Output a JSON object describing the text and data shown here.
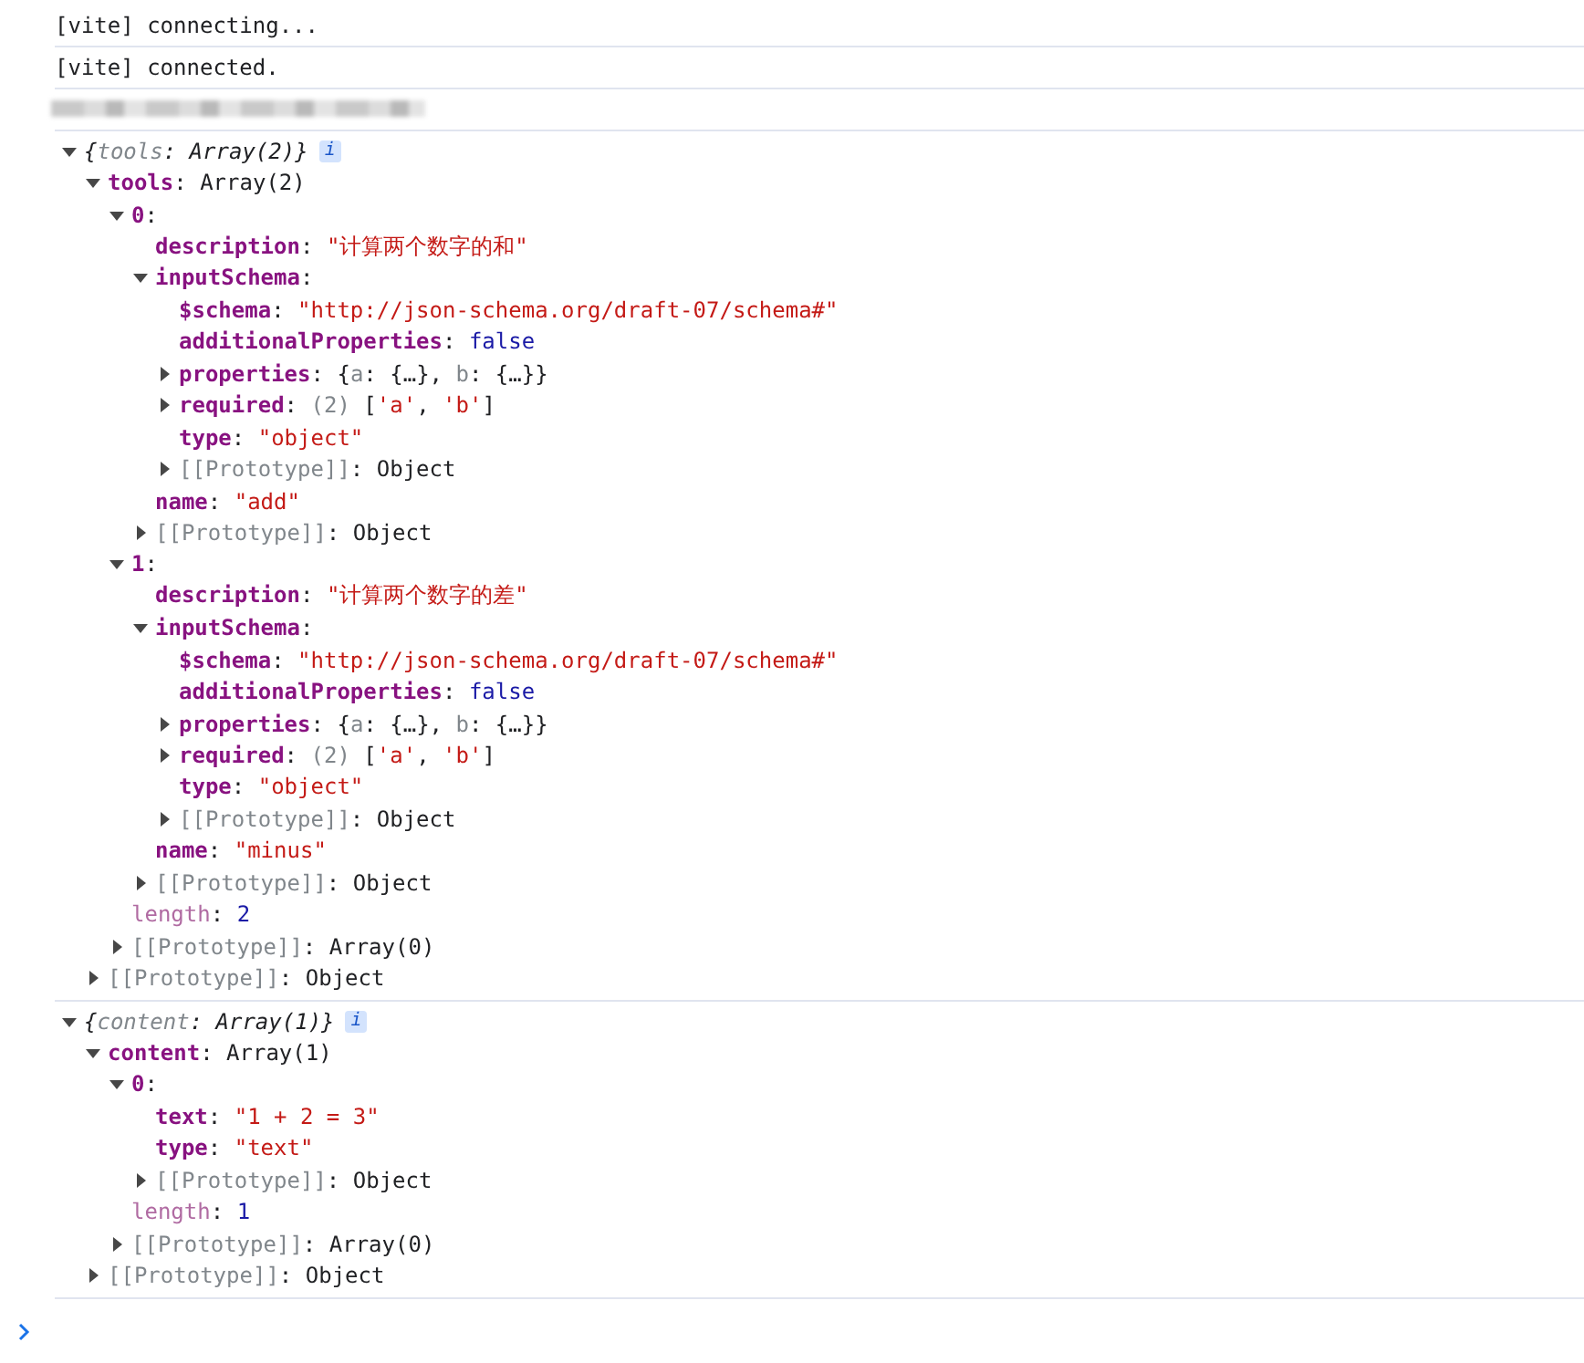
{
  "messages": [
    {
      "kind": "text",
      "text": "[vite] connecting..."
    },
    {
      "kind": "text",
      "text": "[vite] connected."
    },
    {
      "kind": "redacted"
    },
    {
      "kind": "object",
      "expanded": true,
      "summary": [
        {
          "text": "{",
          "kind": "plain"
        },
        {
          "text": "tools",
          "kind": "dim"
        },
        {
          "text": ": Array(2)}",
          "kind": "plain"
        }
      ],
      "badge": "i",
      "children": [
        {
          "expanded": true,
          "line": [
            {
              "text": "tools",
              "kind": "key"
            },
            {
              "text": ": Array(2)",
              "kind": "plain"
            }
          ],
          "children": [
            {
              "expanded": true,
              "line": [
                {
                  "text": "0",
                  "kind": "key"
                },
                {
                  "text": ":",
                  "kind": "plain"
                }
              ],
              "children": [
                {
                  "line": [
                    {
                      "text": "description",
                      "kind": "key"
                    },
                    {
                      "text": ": ",
                      "kind": "plain"
                    },
                    {
                      "text": "\"计算两个数字的和\"",
                      "kind": "string"
                    }
                  ]
                },
                {
                  "expanded": true,
                  "line": [
                    {
                      "text": "inputSchema",
                      "kind": "key"
                    },
                    {
                      "text": ":",
                      "kind": "plain"
                    }
                  ],
                  "children": [
                    {
                      "line": [
                        {
                          "text": "$schema",
                          "kind": "key"
                        },
                        {
                          "text": ": ",
                          "kind": "plain"
                        },
                        {
                          "text": "\"http://json-schema.org/draft-07/schema#\"",
                          "kind": "string"
                        }
                      ]
                    },
                    {
                      "line": [
                        {
                          "text": "additionalProperties",
                          "kind": "key"
                        },
                        {
                          "text": ": ",
                          "kind": "plain"
                        },
                        {
                          "text": "false",
                          "kind": "keyword"
                        }
                      ]
                    },
                    {
                      "expanded": false,
                      "line": [
                        {
                          "text": "properties",
                          "kind": "key"
                        },
                        {
                          "text": ": {",
                          "kind": "plain"
                        },
                        {
                          "text": "a",
                          "kind": "dim"
                        },
                        {
                          "text": ": {…}, ",
                          "kind": "plain"
                        },
                        {
                          "text": "b",
                          "kind": "dim"
                        },
                        {
                          "text": ": {…}}",
                          "kind": "plain"
                        }
                      ]
                    },
                    {
                      "expanded": false,
                      "line": [
                        {
                          "text": "required",
                          "kind": "key"
                        },
                        {
                          "text": ": ",
                          "kind": "plain"
                        },
                        {
                          "text": "(2)",
                          "kind": "dim"
                        },
                        {
                          "text": " [",
                          "kind": "plain"
                        },
                        {
                          "text": "'a'",
                          "kind": "string"
                        },
                        {
                          "text": ", ",
                          "kind": "plain"
                        },
                        {
                          "text": "'b'",
                          "kind": "string"
                        },
                        {
                          "text": "]",
                          "kind": "plain"
                        }
                      ]
                    },
                    {
                      "line": [
                        {
                          "text": "type",
                          "kind": "key"
                        },
                        {
                          "text": ": ",
                          "kind": "plain"
                        },
                        {
                          "text": "\"object\"",
                          "kind": "string"
                        }
                      ]
                    },
                    {
                      "expanded": false,
                      "line": [
                        {
                          "text": "[[Prototype]]",
                          "kind": "dim"
                        },
                        {
                          "text": ": Object",
                          "kind": "plain"
                        }
                      ]
                    }
                  ]
                },
                {
                  "line": [
                    {
                      "text": "name",
                      "kind": "key"
                    },
                    {
                      "text": ": ",
                      "kind": "plain"
                    },
                    {
                      "text": "\"add\"",
                      "kind": "string"
                    }
                  ]
                },
                {
                  "expanded": false,
                  "line": [
                    {
                      "text": "[[Prototype]]",
                      "kind": "dim"
                    },
                    {
                      "text": ": Object",
                      "kind": "plain"
                    }
                  ]
                }
              ]
            },
            {
              "expanded": true,
              "line": [
                {
                  "text": "1",
                  "kind": "key"
                },
                {
                  "text": ":",
                  "kind": "plain"
                }
              ],
              "children": [
                {
                  "line": [
                    {
                      "text": "description",
                      "kind": "key"
                    },
                    {
                      "text": ": ",
                      "kind": "plain"
                    },
                    {
                      "text": "\"计算两个数字的差\"",
                      "kind": "string"
                    }
                  ]
                },
                {
                  "expanded": true,
                  "line": [
                    {
                      "text": "inputSchema",
                      "kind": "key"
                    },
                    {
                      "text": ":",
                      "kind": "plain"
                    }
                  ],
                  "children": [
                    {
                      "line": [
                        {
                          "text": "$schema",
                          "kind": "key"
                        },
                        {
                          "text": ": ",
                          "kind": "plain"
                        },
                        {
                          "text": "\"http://json-schema.org/draft-07/schema#\"",
                          "kind": "string"
                        }
                      ]
                    },
                    {
                      "line": [
                        {
                          "text": "additionalProperties",
                          "kind": "key"
                        },
                        {
                          "text": ": ",
                          "kind": "plain"
                        },
                        {
                          "text": "false",
                          "kind": "keyword"
                        }
                      ]
                    },
                    {
                      "expanded": false,
                      "line": [
                        {
                          "text": "properties",
                          "kind": "key"
                        },
                        {
                          "text": ": {",
                          "kind": "plain"
                        },
                        {
                          "text": "a",
                          "kind": "dim"
                        },
                        {
                          "text": ": {…}, ",
                          "kind": "plain"
                        },
                        {
                          "text": "b",
                          "kind": "dim"
                        },
                        {
                          "text": ": {…}}",
                          "kind": "plain"
                        }
                      ]
                    },
                    {
                      "expanded": false,
                      "line": [
                        {
                          "text": "required",
                          "kind": "key"
                        },
                        {
                          "text": ": ",
                          "kind": "plain"
                        },
                        {
                          "text": "(2)",
                          "kind": "dim"
                        },
                        {
                          "text": " [",
                          "kind": "plain"
                        },
                        {
                          "text": "'a'",
                          "kind": "string"
                        },
                        {
                          "text": ", ",
                          "kind": "plain"
                        },
                        {
                          "text": "'b'",
                          "kind": "string"
                        },
                        {
                          "text": "]",
                          "kind": "plain"
                        }
                      ]
                    },
                    {
                      "line": [
                        {
                          "text": "type",
                          "kind": "key"
                        },
                        {
                          "text": ": ",
                          "kind": "plain"
                        },
                        {
                          "text": "\"object\"",
                          "kind": "string"
                        }
                      ]
                    },
                    {
                      "expanded": false,
                      "line": [
                        {
                          "text": "[[Prototype]]",
                          "kind": "dim"
                        },
                        {
                          "text": ": Object",
                          "kind": "plain"
                        }
                      ]
                    }
                  ]
                },
                {
                  "line": [
                    {
                      "text": "name",
                      "kind": "key"
                    },
                    {
                      "text": ": ",
                      "kind": "plain"
                    },
                    {
                      "text": "\"minus\"",
                      "kind": "string"
                    }
                  ]
                },
                {
                  "expanded": false,
                  "line": [
                    {
                      "text": "[[Prototype]]",
                      "kind": "dim"
                    },
                    {
                      "text": ": Object",
                      "kind": "plain"
                    }
                  ]
                }
              ]
            },
            {
              "line": [
                {
                  "text": "length",
                  "kind": "inherited"
                },
                {
                  "text": ": ",
                  "kind": "plain"
                },
                {
                  "text": "2",
                  "kind": "keyword"
                }
              ]
            },
            {
              "expanded": false,
              "line": [
                {
                  "text": "[[Prototype]]",
                  "kind": "dim"
                },
                {
                  "text": ": Array(0)",
                  "kind": "plain"
                }
              ]
            }
          ]
        },
        {
          "expanded": false,
          "line": [
            {
              "text": "[[Prototype]]",
              "kind": "dim"
            },
            {
              "text": ": Object",
              "kind": "plain"
            }
          ]
        }
      ]
    },
    {
      "kind": "object",
      "expanded": true,
      "summary": [
        {
          "text": "{",
          "kind": "plain"
        },
        {
          "text": "content",
          "kind": "dim"
        },
        {
          "text": ": Array(1)}",
          "kind": "plain"
        }
      ],
      "badge": "i",
      "children": [
        {
          "expanded": true,
          "line": [
            {
              "text": "content",
              "kind": "key"
            },
            {
              "text": ": Array(1)",
              "kind": "plain"
            }
          ],
          "children": [
            {
              "expanded": true,
              "line": [
                {
                  "text": "0",
                  "kind": "key"
                },
                {
                  "text": ":",
                  "kind": "plain"
                }
              ],
              "children": [
                {
                  "line": [
                    {
                      "text": "text",
                      "kind": "key"
                    },
                    {
                      "text": ": ",
                      "kind": "plain"
                    },
                    {
                      "text": "\"1 + 2 = 3\"",
                      "kind": "string"
                    }
                  ]
                },
                {
                  "line": [
                    {
                      "text": "type",
                      "kind": "key"
                    },
                    {
                      "text": ": ",
                      "kind": "plain"
                    },
                    {
                      "text": "\"text\"",
                      "kind": "string"
                    }
                  ]
                },
                {
                  "expanded": false,
                  "line": [
                    {
                      "text": "[[Prototype]]",
                      "kind": "dim"
                    },
                    {
                      "text": ": Object",
                      "kind": "plain"
                    }
                  ]
                }
              ]
            },
            {
              "line": [
                {
                  "text": "length",
                  "kind": "inherited"
                },
                {
                  "text": ": ",
                  "kind": "plain"
                },
                {
                  "text": "1",
                  "kind": "keyword"
                }
              ]
            },
            {
              "expanded": false,
              "line": [
                {
                  "text": "[[Prototype]]",
                  "kind": "dim"
                },
                {
                  "text": ": Array(0)",
                  "kind": "plain"
                }
              ]
            }
          ]
        },
        {
          "expanded": false,
          "line": [
            {
              "text": "[[Prototype]]",
              "kind": "dim"
            },
            {
              "text": ": Object",
              "kind": "plain"
            }
          ]
        }
      ]
    }
  ]
}
